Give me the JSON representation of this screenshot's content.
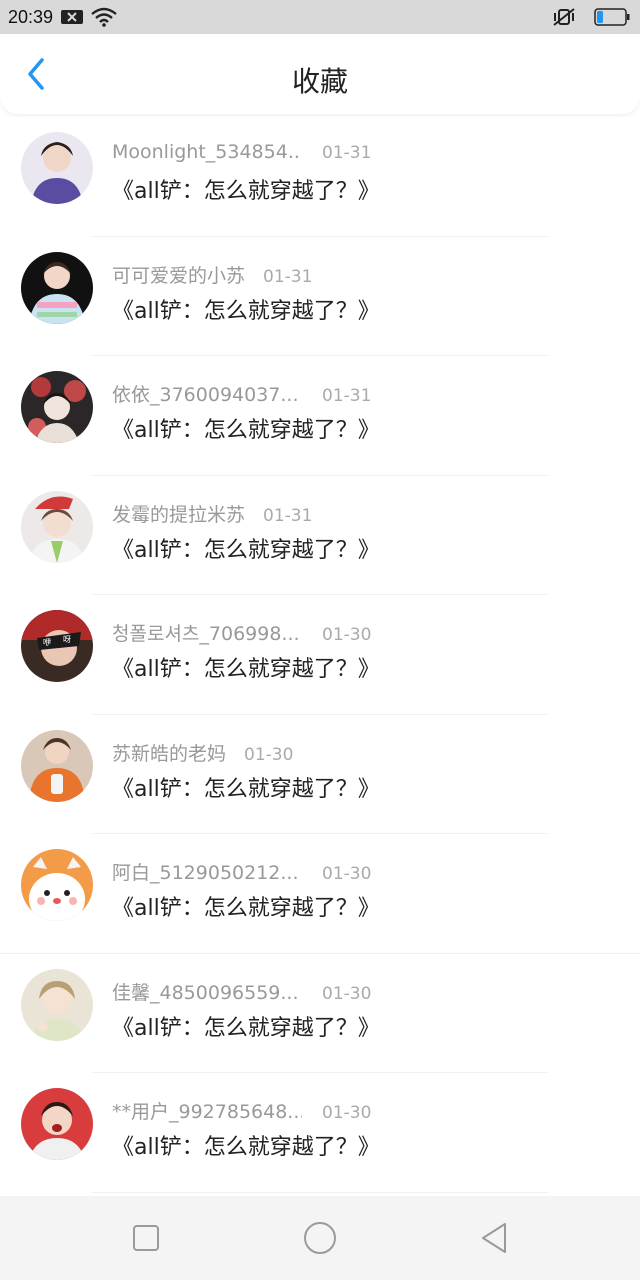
{
  "status_bar": {
    "time": "20:39",
    "icons": [
      "notification-x-icon",
      "wifi-icon",
      "mute-vibrate-icon",
      "battery-icon"
    ]
  },
  "header": {
    "title": "收藏",
    "back_icon": "chevron-left-icon",
    "accent_color": "#2196f3"
  },
  "items": [
    {
      "username": "Moonlight_534854...",
      "date": "01-31",
      "title": "《all铲：怎么就穿越了？》"
    },
    {
      "username": "可可爱爱的小苏",
      "date": "01-31",
      "title": "《all铲：怎么就穿越了？》"
    },
    {
      "username": "依依_3760094037...",
      "date": "01-31",
      "title": "《all铲：怎么就穿越了？》"
    },
    {
      "username": "发霉的提拉米苏",
      "date": "01-31",
      "title": "《all铲：怎么就穿越了？》"
    },
    {
      "username": "청폴로셔츠_706998...",
      "date": "01-30",
      "title": "《all铲：怎么就穿越了？》"
    },
    {
      "username": "苏新皓的老妈",
      "date": "01-30",
      "title": "《all铲：怎么就穿越了？》"
    },
    {
      "username": "阿白_5129050212...",
      "date": "01-30",
      "title": "《all铲：怎么就穿越了？》"
    },
    {
      "username": "佳馨_4850096559...",
      "date": "01-30",
      "title": "《all铲：怎么就穿越了？》"
    },
    {
      "username": "**用户_992785648...",
      "date": "01-30",
      "title": "《all铲：怎么就穿越了？》"
    }
  ],
  "nav_bar": {
    "icons": [
      "recents-square-icon",
      "home-circle-icon",
      "back-triangle-icon"
    ]
  }
}
